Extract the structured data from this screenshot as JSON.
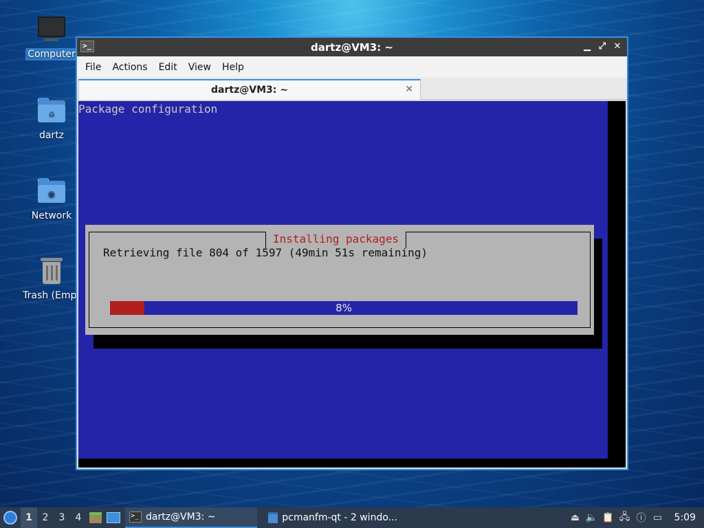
{
  "desktop": {
    "icons": [
      {
        "label": "Computer",
        "icon": "computer-icon"
      },
      {
        "label": "dartz",
        "icon": "home-folder-icon"
      },
      {
        "label": "Network",
        "icon": "network-folder-icon"
      },
      {
        "label": "Trash (Empt",
        "icon": "trash-icon"
      }
    ]
  },
  "window": {
    "title": "dartz@VM3: ~",
    "controls": {
      "minimize": "▁",
      "maximize": "⤢",
      "close": "✕"
    },
    "menu": [
      "File",
      "Actions",
      "Edit",
      "View",
      "Help"
    ],
    "tab": {
      "label": "dartz@VM3: ~",
      "close": "✕"
    }
  },
  "terminal": {
    "header": "Package configuration",
    "dialog": {
      "title": "Installing packages",
      "message": "Retrieving file 804 of 1597 (49min 51s remaining)",
      "progress_percent": 8,
      "progress_label": "8%"
    }
  },
  "taskbar": {
    "workspaces": [
      "1",
      "2",
      "3",
      "4"
    ],
    "active_workspace": "1",
    "tasks": [
      {
        "label": "dartz@VM3: ~",
        "icon": "terminal-icon",
        "active": true
      },
      {
        "label": "pcmanfm-qt - 2 windo...",
        "icon": "folder-icon",
        "active": false
      }
    ],
    "clock": "5:09"
  },
  "colors": {
    "terminal_blue": "#2424a8",
    "dialog_gray": "#b4b4b4",
    "progress_red": "#b01e1e",
    "accent": "#3a8fe0"
  }
}
